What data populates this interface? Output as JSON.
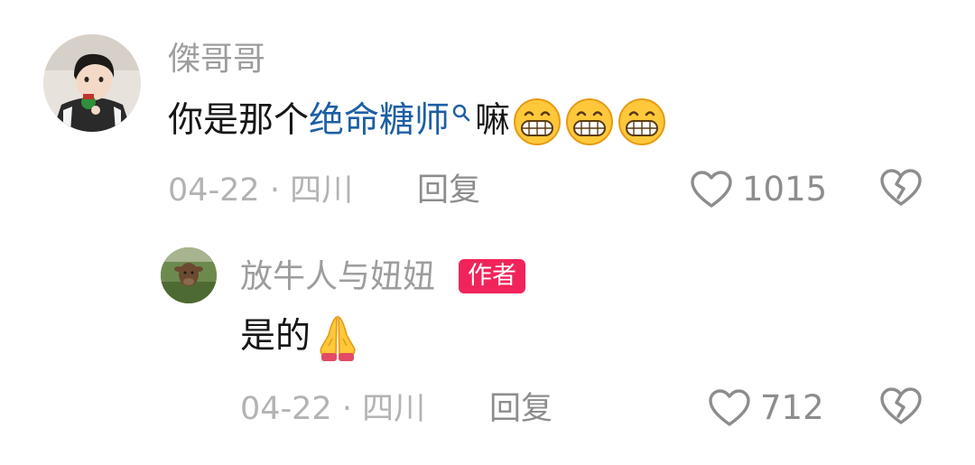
{
  "comment": {
    "username": "傑哥哥",
    "text_before": "你是那个",
    "keyword": "绝命糖师",
    "text_after": "嘛",
    "emoji_icon": "grinning-face-icon",
    "emoji_count": 3,
    "date_location": "04-22 · 四川",
    "reply_label": "回复",
    "like_count": "1015"
  },
  "reply": {
    "username": "放牛人与妞妞",
    "badge": "作者",
    "text": "是的",
    "emoji_icon": "folded-hands-icon",
    "date_location": "04-22 · 四川",
    "reply_label": "回复",
    "like_count": "712"
  },
  "colors": {
    "username": "#9d9d9d",
    "keyword_link": "#1d5fa5",
    "badge_bg": "#f0245a",
    "meta": "#b3b3b3",
    "icon": "#8d8d8d"
  }
}
